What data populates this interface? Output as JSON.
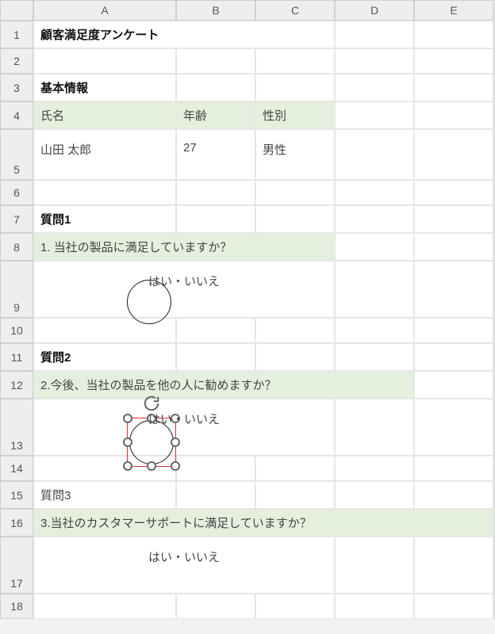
{
  "columns": [
    "A",
    "B",
    "C",
    "D",
    "E"
  ],
  "rows": [
    "1",
    "2",
    "3",
    "4",
    "5",
    "6",
    "7",
    "8",
    "9",
    "10",
    "11",
    "12",
    "13",
    "14",
    "15",
    "16",
    "17",
    "18"
  ],
  "title": "顧客満足度アンケート",
  "section_basic": "基本情報",
  "labels": {
    "name": "氏名",
    "age": "年齢",
    "gender": "性別"
  },
  "values": {
    "name": "山田 太郎",
    "age": "27",
    "gender": "男性"
  },
  "q1_label": "質問1",
  "q1_text": "1. 当社の製品に満足していますか？",
  "q2_label": "質問2",
  "q2_text": "2.今後、当社の製品を他の人に勧めますか？",
  "q3_label": "質問3",
  "q3_text": "3.当社のカスタマーサポートに満足していますか？",
  "answer": "はい・いいえ",
  "yes": "はい",
  "no": "いいえ"
}
